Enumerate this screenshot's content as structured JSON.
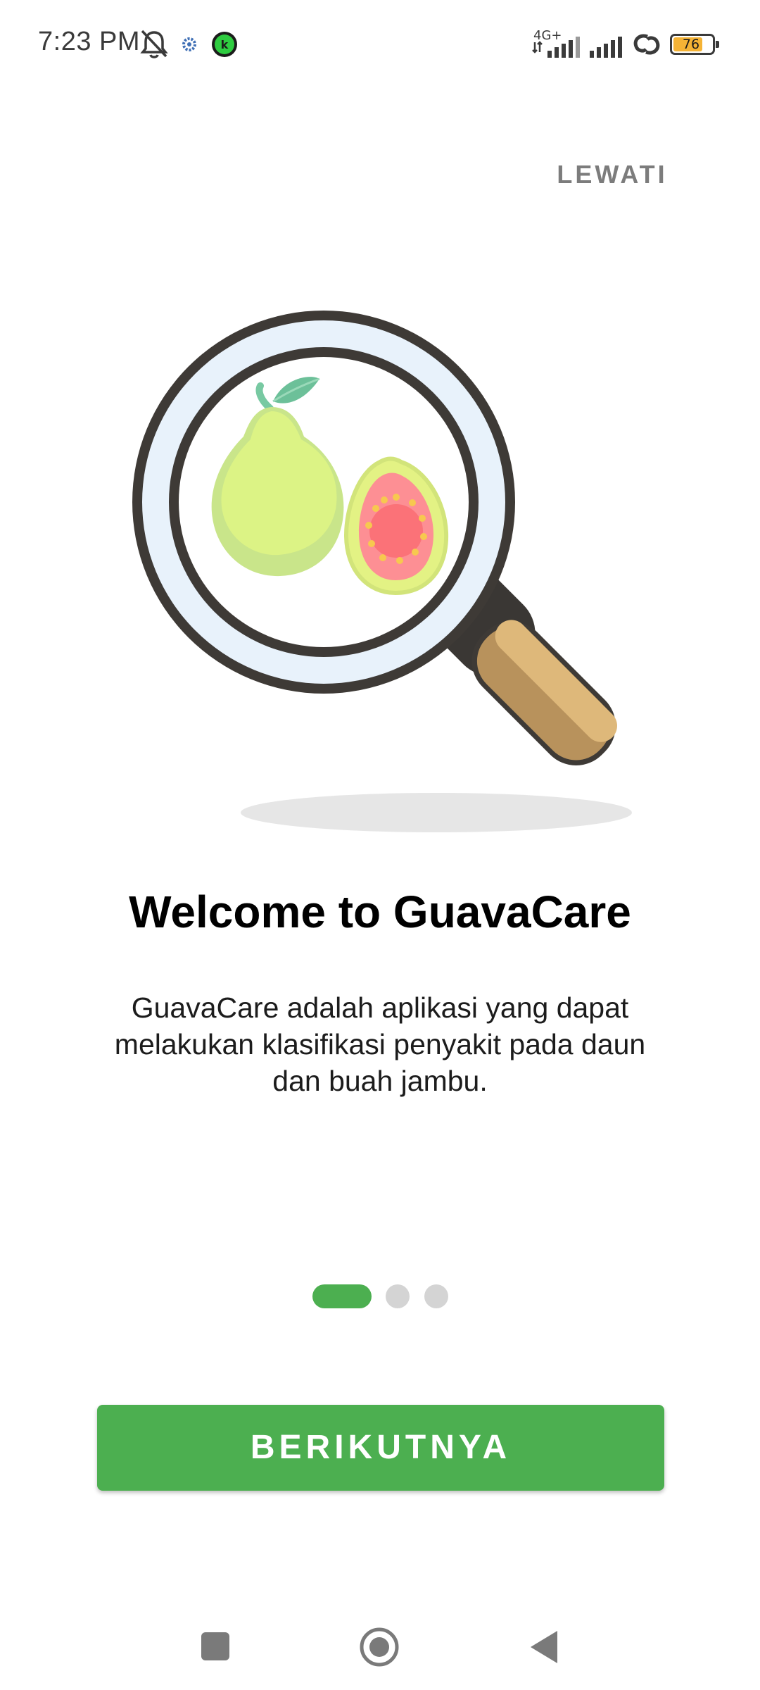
{
  "status_bar": {
    "time": "7:23 PM",
    "network_type": "4G+",
    "battery_level": "76",
    "icons": [
      "bell-off-icon",
      "settings-gear-icon",
      "k-app-icon",
      "signal-icon",
      "signal-icon",
      "hotspot-icon",
      "battery-icon"
    ]
  },
  "onboarding": {
    "skip_label": "LEWATI",
    "title": "Welcome to GuavaCare",
    "description": "GuavaCare adalah aplikasi yang dapat melakukan klasifikasi penyakit pada daun dan buah jambu.",
    "pages_total": 3,
    "current_page": 1,
    "next_label": "BERIKUTNYA",
    "illustration": "magnifier-guava-icon"
  },
  "colors": {
    "accent": "#4caf50",
    "skip_text": "#7c7c7c",
    "indicator_inactive": "#d4d4d4"
  },
  "nav_bar": {
    "buttons": [
      "recents-square-icon",
      "home-circle-icon",
      "back-triangle-icon"
    ]
  }
}
